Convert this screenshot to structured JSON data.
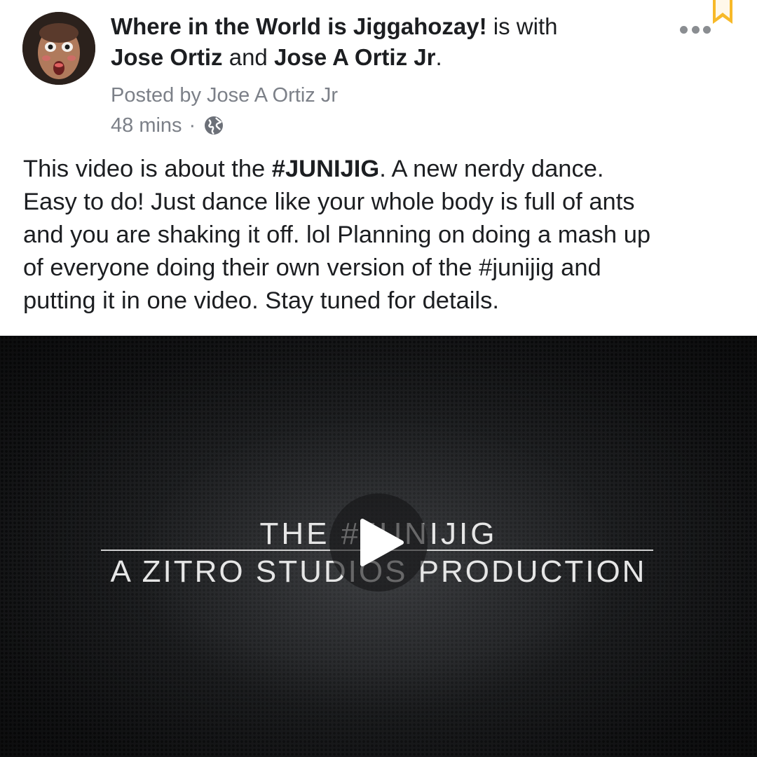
{
  "header": {
    "page_name": "Where in the World is Jiggahozay!",
    "with_text": " is with",
    "tagged_1": "Jose Ortiz",
    "and_text": " and ",
    "tagged_2": "Jose A Ortiz Jr",
    "end_period": "."
  },
  "meta": {
    "posted_by": "Posted by Jose A Ortiz Jr",
    "time": "48 mins",
    "separator": "·",
    "privacy_icon": "globe-icon"
  },
  "post": {
    "text_before": "This video is about the ",
    "hashtag": "#JUNIJIG",
    "text_after": ".  A new nerdy dance.\nEasy to do!  Just dance like your whole body is full of ants\nand you are shaking it off. lol  Planning on doing a mash up\nof everyone doing their own version of the #junijig and\nputting it in one video.  Stay tuned for details."
  },
  "video": {
    "title_line1": "THE #JUNIJIG",
    "title_line2": "A ZITRO STUDIOS  PRODUCTION",
    "play_icon": "play-icon"
  },
  "icons": {
    "more": "more-options-icon",
    "bookmark": "bookmark-icon"
  },
  "colors": {
    "text": "#1c1e21",
    "meta": "#7c8088",
    "bookmark": "#f7b928"
  }
}
